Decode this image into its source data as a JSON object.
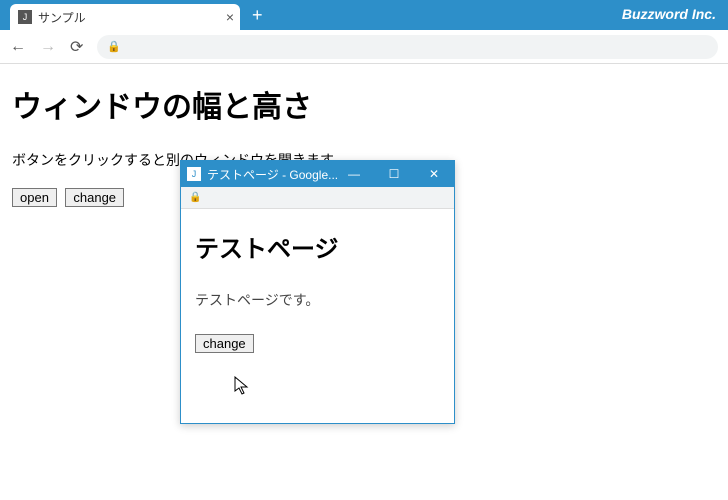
{
  "browser": {
    "brand": "Buzzword Inc.",
    "tab_title": "サンプル",
    "new_tab": "+"
  },
  "toolbar": {
    "back": "←",
    "forward": "→",
    "reload": "⟳",
    "lock_icon": "🔒"
  },
  "page": {
    "heading": "ウィンドウの幅と高さ",
    "paragraph": "ボタンをクリックすると別のウィンドウを開きます。",
    "open_label": "open",
    "change_label": "change"
  },
  "popup": {
    "title": "テストページ - Google...",
    "minimize": "—",
    "maximize": "☐",
    "close": "✕",
    "lock_icon": "🔒",
    "heading": "テストページ",
    "paragraph": "テストページです。",
    "change_label": "change"
  }
}
